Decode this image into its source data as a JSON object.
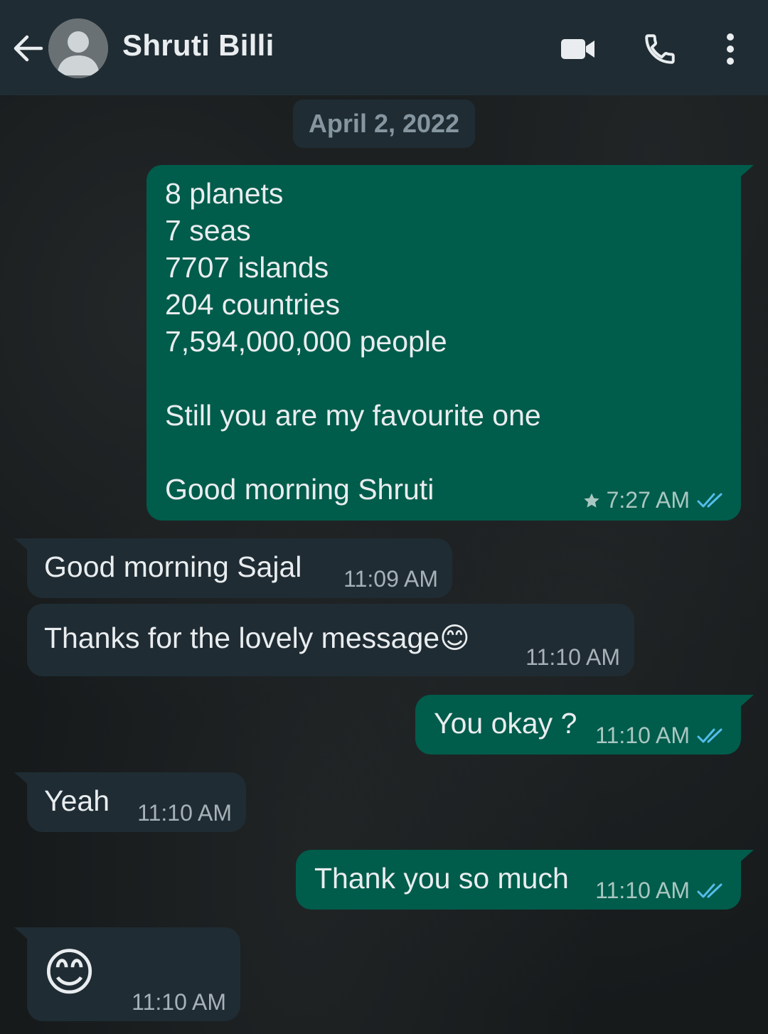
{
  "header": {
    "contact_name": "Shruti Billi"
  },
  "date_chip": "April 2, 2022",
  "messages": [
    {
      "direction": "outgoing",
      "lines": [
        "8 planets",
        "7 seas",
        "7707 islands",
        "204 countries",
        "7,594,000,000 people",
        "",
        "Still you are my favourite one",
        "",
        "Good morning Shruti"
      ],
      "time": "7:27 AM",
      "starred": true,
      "status": "read"
    },
    {
      "direction": "incoming",
      "text": "Good morning Sajal",
      "time": "11:09 AM"
    },
    {
      "direction": "incoming",
      "text": "Thanks for the lovely message😊",
      "time": "11:10 AM"
    },
    {
      "direction": "outgoing",
      "text": "You okay ?",
      "time": "11:10 AM",
      "status": "read"
    },
    {
      "direction": "incoming",
      "text": "Yeah",
      "time": "11:10 AM"
    },
    {
      "direction": "outgoing",
      "text": "Thank you so much",
      "time": "11:10 AM",
      "status": "read"
    },
    {
      "direction": "incoming",
      "text": "😊",
      "time": "11:10 AM"
    }
  ],
  "colors": {
    "header_bg": "#1f2c33",
    "outgoing_bubble": "#005c4b",
    "incoming_bubble": "#1f2c33",
    "read_tick": "#53bdeb",
    "text": "#e9edef"
  },
  "icons": {
    "back": "arrow-left-icon",
    "avatar": "default-avatar-icon",
    "video": "video-camera-icon",
    "call": "phone-icon",
    "menu": "more-vertical-icon",
    "star": "star-icon",
    "ticks": "double-check-icon"
  }
}
